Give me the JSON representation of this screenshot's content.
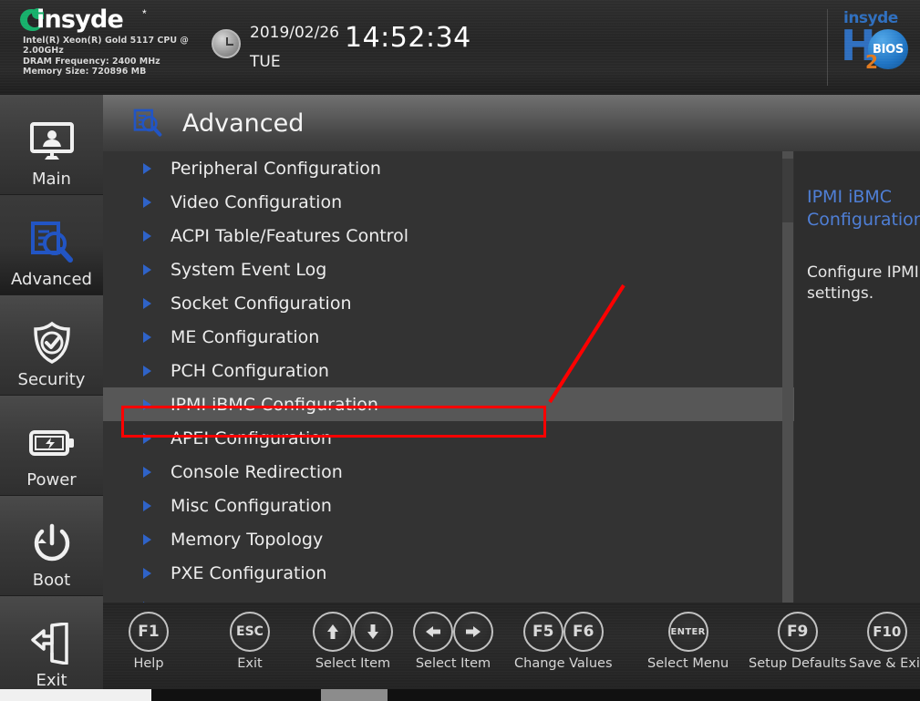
{
  "header": {
    "brand_name": "insyde",
    "brand_star": "*",
    "system_info": "Intel(R) Xeon(R) Gold 5117 CPU @\n2.00GHz\nDRAM Frequency: 2400 MHz\nMemory Size: 720896 MB",
    "date": "2019/02/26",
    "weekday": "TUE",
    "time": "14:52:34",
    "logo": {
      "insyde": "insyde",
      "h": "H",
      "subscript": "2",
      "bios": "BIOS"
    }
  },
  "sidebar": {
    "items": [
      {
        "label": "Main",
        "icon": "monitor-user-icon",
        "active": false
      },
      {
        "label": "Advanced",
        "icon": "document-magnifier-icon",
        "active": true
      },
      {
        "label": "Security",
        "icon": "shield-check-icon",
        "active": false
      },
      {
        "label": "Power",
        "icon": "battery-bolt-icon",
        "active": false
      },
      {
        "label": "Boot",
        "icon": "power-symbol-icon",
        "active": false
      },
      {
        "label": "Exit",
        "icon": "door-exit-icon",
        "active": false
      }
    ]
  },
  "page": {
    "title": "Advanced",
    "icon": "document-magnifier-icon"
  },
  "menu": {
    "items": [
      {
        "label": "Peripheral Configuration",
        "selected": false
      },
      {
        "label": "Video Configuration",
        "selected": false
      },
      {
        "label": "ACPI Table/Features Control",
        "selected": false
      },
      {
        "label": "System Event Log",
        "selected": false
      },
      {
        "label": "Socket Configuration",
        "selected": false
      },
      {
        "label": "ME Configuration",
        "selected": false
      },
      {
        "label": "PCH Configuration",
        "selected": false
      },
      {
        "label": "IPMI iBMC Configuration",
        "selected": true
      },
      {
        "label": "APEI Configuration",
        "selected": false
      },
      {
        "label": "Console Redirection",
        "selected": false
      },
      {
        "label": "Misc Configuration",
        "selected": false
      },
      {
        "label": "Memory Topology",
        "selected": false
      },
      {
        "label": "PXE Configuration",
        "selected": false
      }
    ]
  },
  "help": {
    "title": "IPMI iBMC Configuration",
    "body": "Configure IPMI iBMC settings.",
    "icon": "document-magnifier-icon"
  },
  "footer": {
    "keys": [
      {
        "keys": [
          "F1"
        ],
        "label": "Help",
        "type": "text"
      },
      {
        "keys": [
          "ESC"
        ],
        "label": "Exit",
        "type": "text"
      },
      {
        "keys": [
          "↑",
          "↓"
        ],
        "label": "Select Item",
        "type": "arrow-vertical"
      },
      {
        "keys": [
          "←",
          "→"
        ],
        "label": "Select Item",
        "type": "arrow-horizontal"
      },
      {
        "keys": [
          "F5",
          "F6"
        ],
        "label": "Change Values",
        "type": "text"
      },
      {
        "keys": [
          "ENTER"
        ],
        "label": "Select Menu",
        "type": "enter"
      },
      {
        "keys": [
          "F9"
        ],
        "label": "Setup Defaults",
        "type": "text"
      },
      {
        "keys": [
          "F10"
        ],
        "label": "Save & Exit",
        "type": "text"
      }
    ]
  },
  "annotation": {
    "color": "#fe0000",
    "target_item": "IPMI iBMC Configuration"
  },
  "colors": {
    "background": "#333333",
    "selected_row": "#575757",
    "accent_blue": "#2f63c8",
    "help_title_blue": "#4f7fd6",
    "annotation_red": "#fe0000"
  }
}
